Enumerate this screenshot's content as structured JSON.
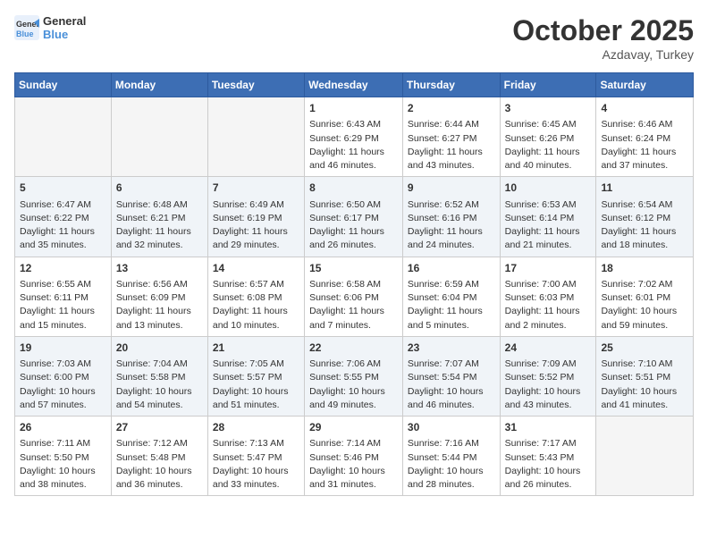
{
  "header": {
    "logo_line1": "General",
    "logo_line2": "Blue",
    "month": "October 2025",
    "location": "Azdavay, Turkey"
  },
  "weekdays": [
    "Sunday",
    "Monday",
    "Tuesday",
    "Wednesday",
    "Thursday",
    "Friday",
    "Saturday"
  ],
  "weeks": [
    [
      {
        "day": "",
        "empty": true
      },
      {
        "day": "",
        "empty": true
      },
      {
        "day": "",
        "empty": true
      },
      {
        "day": "1",
        "sun": "6:43 AM",
        "set": "6:29 PM",
        "day_text": "11 hours and 46 minutes."
      },
      {
        "day": "2",
        "sun": "6:44 AM",
        "set": "6:27 PM",
        "day_text": "11 hours and 43 minutes."
      },
      {
        "day": "3",
        "sun": "6:45 AM",
        "set": "6:26 PM",
        "day_text": "11 hours and 40 minutes."
      },
      {
        "day": "4",
        "sun": "6:46 AM",
        "set": "6:24 PM",
        "day_text": "11 hours and 37 minutes."
      }
    ],
    [
      {
        "day": "5",
        "sun": "6:47 AM",
        "set": "6:22 PM",
        "day_text": "11 hours and 35 minutes."
      },
      {
        "day": "6",
        "sun": "6:48 AM",
        "set": "6:21 PM",
        "day_text": "11 hours and 32 minutes."
      },
      {
        "day": "7",
        "sun": "6:49 AM",
        "set": "6:19 PM",
        "day_text": "11 hours and 29 minutes."
      },
      {
        "day": "8",
        "sun": "6:50 AM",
        "set": "6:17 PM",
        "day_text": "11 hours and 26 minutes."
      },
      {
        "day": "9",
        "sun": "6:52 AM",
        "set": "6:16 PM",
        "day_text": "11 hours and 24 minutes."
      },
      {
        "day": "10",
        "sun": "6:53 AM",
        "set": "6:14 PM",
        "day_text": "11 hours and 21 minutes."
      },
      {
        "day": "11",
        "sun": "6:54 AM",
        "set": "6:12 PM",
        "day_text": "11 hours and 18 minutes."
      }
    ],
    [
      {
        "day": "12",
        "sun": "6:55 AM",
        "set": "6:11 PM",
        "day_text": "11 hours and 15 minutes."
      },
      {
        "day": "13",
        "sun": "6:56 AM",
        "set": "6:09 PM",
        "day_text": "11 hours and 13 minutes."
      },
      {
        "day": "14",
        "sun": "6:57 AM",
        "set": "6:08 PM",
        "day_text": "11 hours and 10 minutes."
      },
      {
        "day": "15",
        "sun": "6:58 AM",
        "set": "6:06 PM",
        "day_text": "11 hours and 7 minutes."
      },
      {
        "day": "16",
        "sun": "6:59 AM",
        "set": "6:04 PM",
        "day_text": "11 hours and 5 minutes."
      },
      {
        "day": "17",
        "sun": "7:00 AM",
        "set": "6:03 PM",
        "day_text": "11 hours and 2 minutes."
      },
      {
        "day": "18",
        "sun": "7:02 AM",
        "set": "6:01 PM",
        "day_text": "10 hours and 59 minutes."
      }
    ],
    [
      {
        "day": "19",
        "sun": "7:03 AM",
        "set": "6:00 PM",
        "day_text": "10 hours and 57 minutes."
      },
      {
        "day": "20",
        "sun": "7:04 AM",
        "set": "5:58 PM",
        "day_text": "10 hours and 54 minutes."
      },
      {
        "day": "21",
        "sun": "7:05 AM",
        "set": "5:57 PM",
        "day_text": "10 hours and 51 minutes."
      },
      {
        "day": "22",
        "sun": "7:06 AM",
        "set": "5:55 PM",
        "day_text": "10 hours and 49 minutes."
      },
      {
        "day": "23",
        "sun": "7:07 AM",
        "set": "5:54 PM",
        "day_text": "10 hours and 46 minutes."
      },
      {
        "day": "24",
        "sun": "7:09 AM",
        "set": "5:52 PM",
        "day_text": "10 hours and 43 minutes."
      },
      {
        "day": "25",
        "sun": "7:10 AM",
        "set": "5:51 PM",
        "day_text": "10 hours and 41 minutes."
      }
    ],
    [
      {
        "day": "26",
        "sun": "7:11 AM",
        "set": "5:50 PM",
        "day_text": "10 hours and 38 minutes."
      },
      {
        "day": "27",
        "sun": "7:12 AM",
        "set": "5:48 PM",
        "day_text": "10 hours and 36 minutes."
      },
      {
        "day": "28",
        "sun": "7:13 AM",
        "set": "5:47 PM",
        "day_text": "10 hours and 33 minutes."
      },
      {
        "day": "29",
        "sun": "7:14 AM",
        "set": "5:46 PM",
        "day_text": "10 hours and 31 minutes."
      },
      {
        "day": "30",
        "sun": "7:16 AM",
        "set": "5:44 PM",
        "day_text": "10 hours and 28 minutes."
      },
      {
        "day": "31",
        "sun": "7:17 AM",
        "set": "5:43 PM",
        "day_text": "10 hours and 26 minutes."
      },
      {
        "day": "",
        "empty": true
      }
    ]
  ],
  "labels": {
    "sunrise": "Sunrise:",
    "sunset": "Sunset:",
    "daylight": "Daylight:"
  }
}
